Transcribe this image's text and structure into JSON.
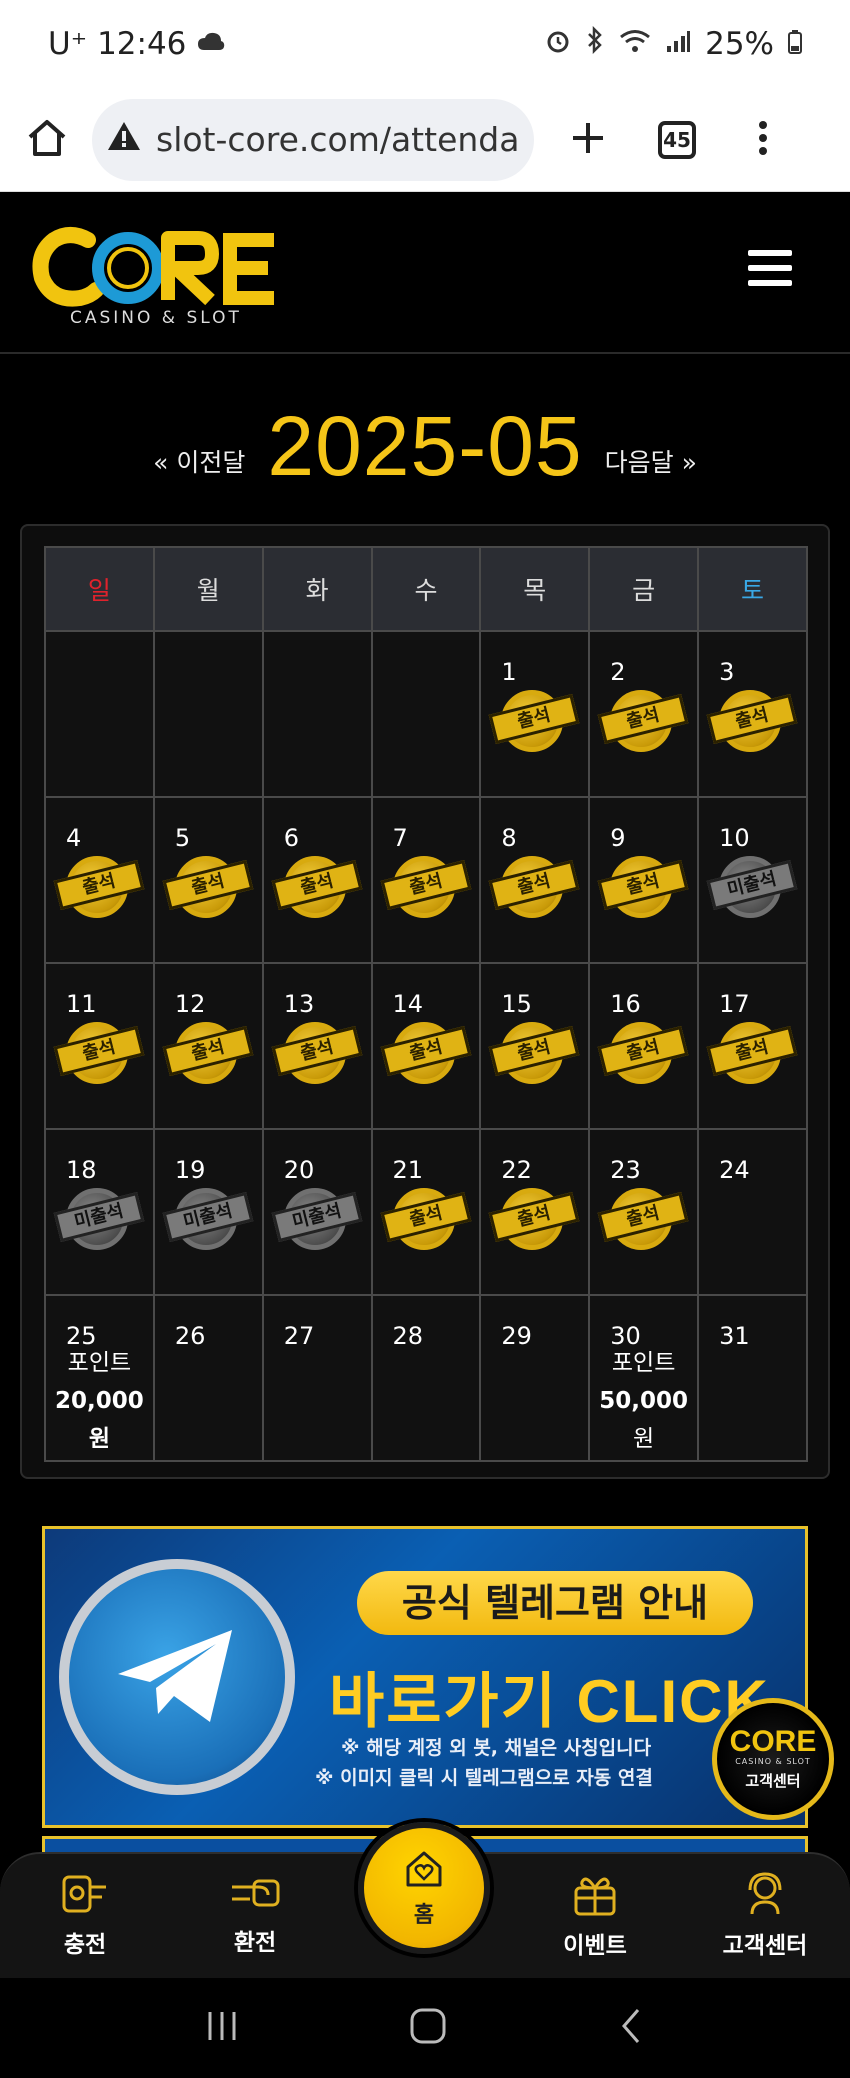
{
  "status_bar": {
    "carrier": "U⁺",
    "time": "12:46",
    "battery": "25%"
  },
  "browser": {
    "url": "slot-core.com/attendance",
    "tab_count": "45"
  },
  "site": {
    "logo_text": "CORE",
    "logo_subtitle": "CASINO & SLOT"
  },
  "calendar": {
    "prev_label": "« 이전달",
    "next_label": "다음달 »",
    "month": "2025-05",
    "weekdays": [
      "일",
      "월",
      "화",
      "수",
      "목",
      "금",
      "토"
    ],
    "stamp_attend": "출석",
    "stamp_absent": "미출석",
    "weeks": [
      [
        null,
        null,
        null,
        null,
        {
          "day": "1",
          "status": "attend"
        },
        {
          "day": "2",
          "status": "attend"
        },
        {
          "day": "3",
          "status": "attend"
        }
      ],
      [
        {
          "day": "4",
          "status": "attend"
        },
        {
          "day": "5",
          "status": "attend"
        },
        {
          "day": "6",
          "status": "attend"
        },
        {
          "day": "7",
          "status": "attend"
        },
        {
          "day": "8",
          "status": "attend"
        },
        {
          "day": "9",
          "status": "attend"
        },
        {
          "day": "10",
          "status": "absent"
        }
      ],
      [
        {
          "day": "11",
          "status": "attend"
        },
        {
          "day": "12",
          "status": "attend"
        },
        {
          "day": "13",
          "status": "attend"
        },
        {
          "day": "14",
          "status": "attend"
        },
        {
          "day": "15",
          "status": "attend"
        },
        {
          "day": "16",
          "status": "attend"
        },
        {
          "day": "17",
          "status": "attend"
        }
      ],
      [
        {
          "day": "18",
          "status": "absent"
        },
        {
          "day": "19",
          "status": "absent"
        },
        {
          "day": "20",
          "status": "absent"
        },
        {
          "day": "21",
          "status": "attend"
        },
        {
          "day": "22",
          "status": "attend"
        },
        {
          "day": "23",
          "status": "attend"
        },
        {
          "day": "24",
          "status": "none"
        }
      ],
      [
        {
          "day": "25",
          "status": "none",
          "reward_label": "포인트",
          "reward_amount": "20,000 원"
        },
        {
          "day": "26",
          "status": "none"
        },
        {
          "day": "27",
          "status": "none"
        },
        {
          "day": "28",
          "status": "none"
        },
        {
          "day": "29",
          "status": "none"
        },
        {
          "day": "30",
          "status": "none",
          "reward_label": "포인트",
          "reward_amount": "50,000",
          "reward_unit": "원"
        },
        {
          "day": "31",
          "status": "none"
        }
      ]
    ]
  },
  "banner": {
    "title": "공식 텔레그램 안내",
    "cta": "바로가기 CLICK",
    "note1": "※ 해당 계정 외 봇, 채널은 사칭입니다",
    "note2": "※ 이미지 클릭 시 텔레그램으로 자동 연결"
  },
  "support_badge": {
    "logo": "CORE",
    "sub": "CASINO & SLOT",
    "label": "고객센터"
  },
  "bottom_nav": {
    "charge": "충전",
    "exchange": "환전",
    "home": "홈",
    "event": "이벤트",
    "support": "고객센터"
  },
  "colors": {
    "gold": "#f5c518",
    "sunday": "#e0222c",
    "saturday": "#39a8e6"
  }
}
